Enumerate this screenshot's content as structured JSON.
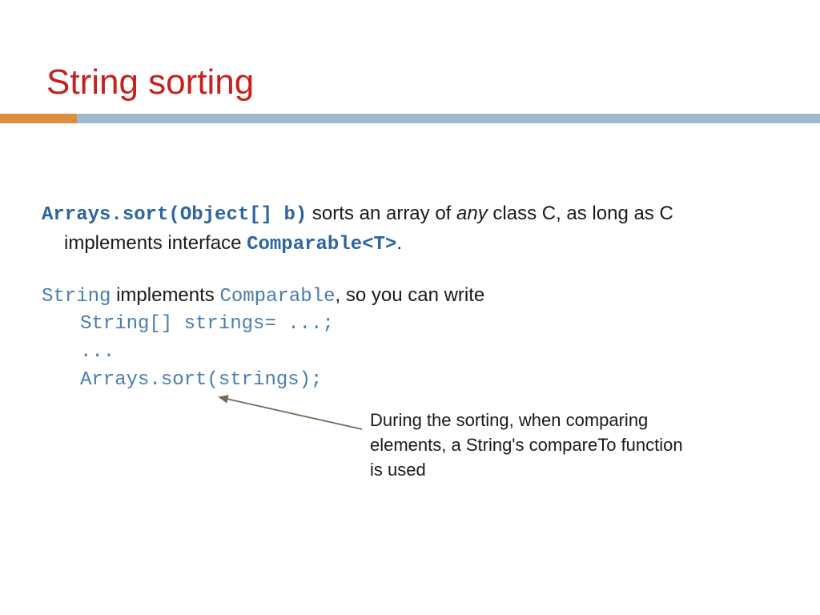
{
  "slide": {
    "title": "String sorting",
    "line1_code": "Arrays.sort(Object[] b)",
    "line1_text1": " sorts an array of ",
    "line1_italic": "any",
    "line1_text2": " class C, as long as C",
    "line2_text1": "implements interface ",
    "line2_code": "Comparable<T>",
    "line2_text2": ".",
    "line3_code1": "String",
    "line3_text1": " implements ",
    "line3_code2": "Comparable",
    "line3_text2": ", so you can write",
    "codeblock_l1": "String[] strings= ...;",
    "codeblock_l2": "...",
    "codeblock_l3": "Arrays.sort(strings);",
    "callout_l1": "During the sorting, when comparing",
    "callout_l2": "elements, a String's compareTo function",
    "callout_l3": "is used"
  }
}
